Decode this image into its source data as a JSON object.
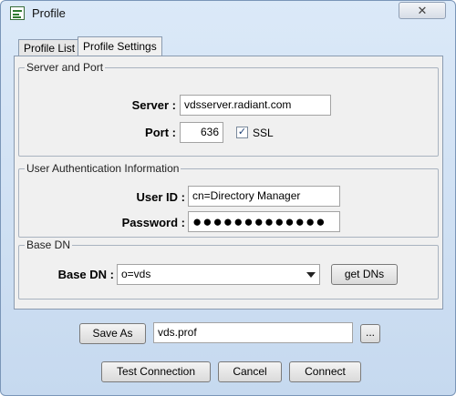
{
  "window": {
    "title": "Profile",
    "close_label": "✕"
  },
  "tabs": [
    {
      "label": "Profile List",
      "active": false
    },
    {
      "label": "Profile Settings",
      "active": true
    }
  ],
  "server_port": {
    "group_title": "Server and Port",
    "server_label": "Server :",
    "server_value": "vdsserver.radiant.com",
    "port_label": "Port :",
    "port_value": "636",
    "ssl_label": "SSL",
    "ssl_checked": "✓"
  },
  "auth": {
    "group_title": "User Authentication Information",
    "userid_label": "User ID :",
    "userid_value": "cn=Directory Manager",
    "password_label": "Password :",
    "password_mask": "●●●●●●●●●●●●●"
  },
  "base_dn": {
    "group_title": "Base DN",
    "label": "Base DN :",
    "value": "o=vds",
    "get_dns_label": "get DNs"
  },
  "profile_file": {
    "save_as_label": "Save As",
    "file_value": "vds.prof",
    "browse_label": "..."
  },
  "footer": {
    "test_connection_label": "Test Connection",
    "cancel_label": "Cancel",
    "connect_label": "Connect"
  },
  "colors": {
    "title_bar": "#c6d9ef",
    "panel": "#f0f0f0",
    "check_mark": "#1c3f74"
  },
  "icons": {
    "app": "profile-app-icon",
    "close": "close-icon",
    "dropdown": "chevron-down-icon"
  }
}
